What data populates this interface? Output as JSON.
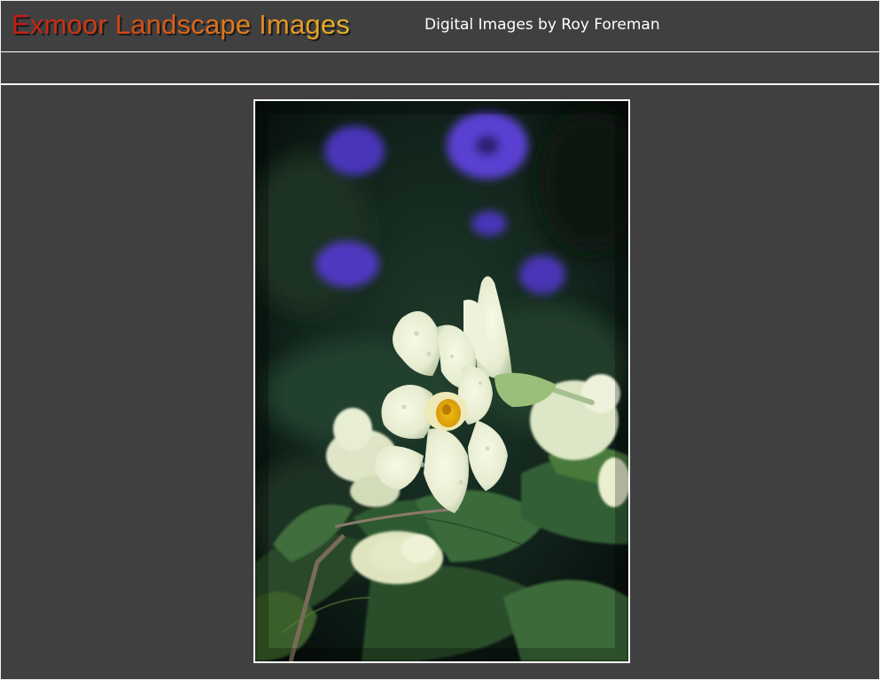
{
  "header": {
    "site_title": "Exmoor Landscape Images",
    "subtitle": "Digital Images by Roy Foreman"
  },
  "photo": {
    "subject": "primrose-flowers-photo"
  },
  "colors": {
    "background": "#404040",
    "divider": "#ffffff",
    "title_gradient_start": "#c41a14",
    "title_gradient_end": "#e8b62a",
    "subtitle_text": "#ffffff"
  }
}
